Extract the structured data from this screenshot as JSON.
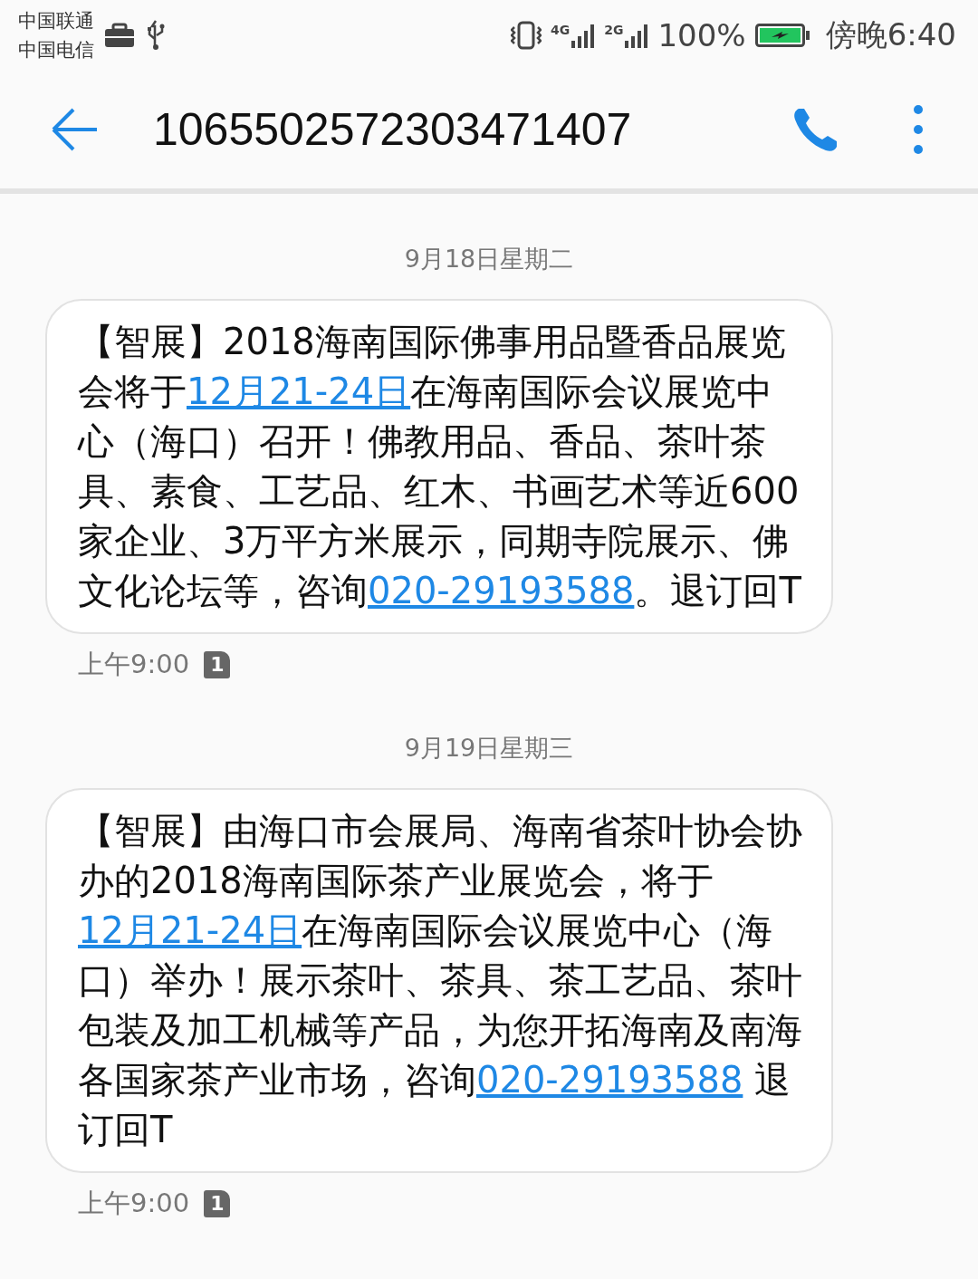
{
  "status_bar": {
    "carriers": [
      "中国联通",
      "中国电信"
    ],
    "network_1": "4G",
    "network_2": "2G",
    "battery": "100%",
    "time": "傍晚6:40"
  },
  "app_bar": {
    "title": "1065502572303471407"
  },
  "messages": [
    {
      "date": "9月18日星期二",
      "parts": [
        {
          "kind": "text",
          "text": "【智展】2018海南国际佛事用品暨香品展览会将于"
        },
        {
          "kind": "link",
          "text": "12月21-24日"
        },
        {
          "kind": "text",
          "text": "在海南国际会议展览中心（海口）召开！佛教用品、香品、茶叶茶具、素食、工艺品、红木、书画艺术等近600家企业、3万平方米展示，同期寺院展示、佛文化论坛等，咨询"
        },
        {
          "kind": "link",
          "text": "020-29193588"
        },
        {
          "kind": "text",
          "text": "。退订回T"
        }
      ],
      "time": "上午9:00",
      "sim": "1"
    },
    {
      "date": "9月19日星期三",
      "parts": [
        {
          "kind": "text",
          "text": "【智展】由海口市会展局、海南省茶叶协会协办的2018海南国际茶产业展览会，将于"
        },
        {
          "kind": "link",
          "text": "12月21-24日"
        },
        {
          "kind": "text",
          "text": "在海南国际会议展览中心（海口）举办！展示茶叶、茶具、茶工艺品、茶叶包装及加工机械等产品，为您开拓海南及南海各国家茶产业市场，咨询"
        },
        {
          "kind": "link",
          "text": "020-29193588"
        },
        {
          "kind": "text",
          "text": " 退订回T"
        }
      ],
      "time": "上午9:00",
      "sim": "1"
    }
  ]
}
